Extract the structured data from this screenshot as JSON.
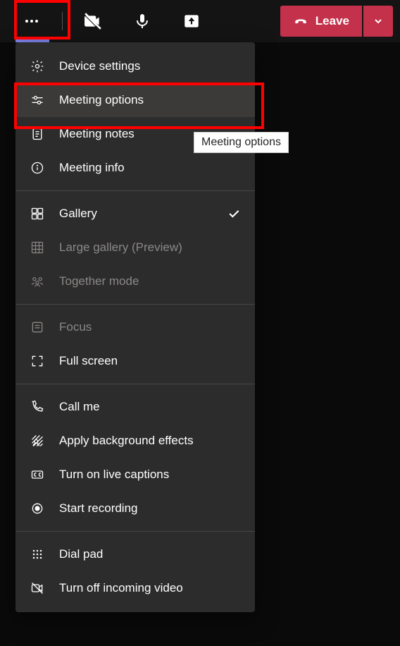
{
  "toolbar": {
    "leave_label": "Leave"
  },
  "menu": {
    "device_settings": "Device settings",
    "meeting_options": "Meeting options",
    "meeting_notes": "Meeting notes",
    "meeting_info": "Meeting info",
    "gallery": "Gallery",
    "large_gallery": "Large gallery (Preview)",
    "together_mode": "Together mode",
    "focus": "Focus",
    "full_screen": "Full screen",
    "call_me": "Call me",
    "apply_background": "Apply background effects",
    "live_captions": "Turn on live captions",
    "start_recording": "Start recording",
    "dial_pad": "Dial pad",
    "turn_off_incoming": "Turn off incoming video"
  },
  "tooltip": "Meeting options"
}
